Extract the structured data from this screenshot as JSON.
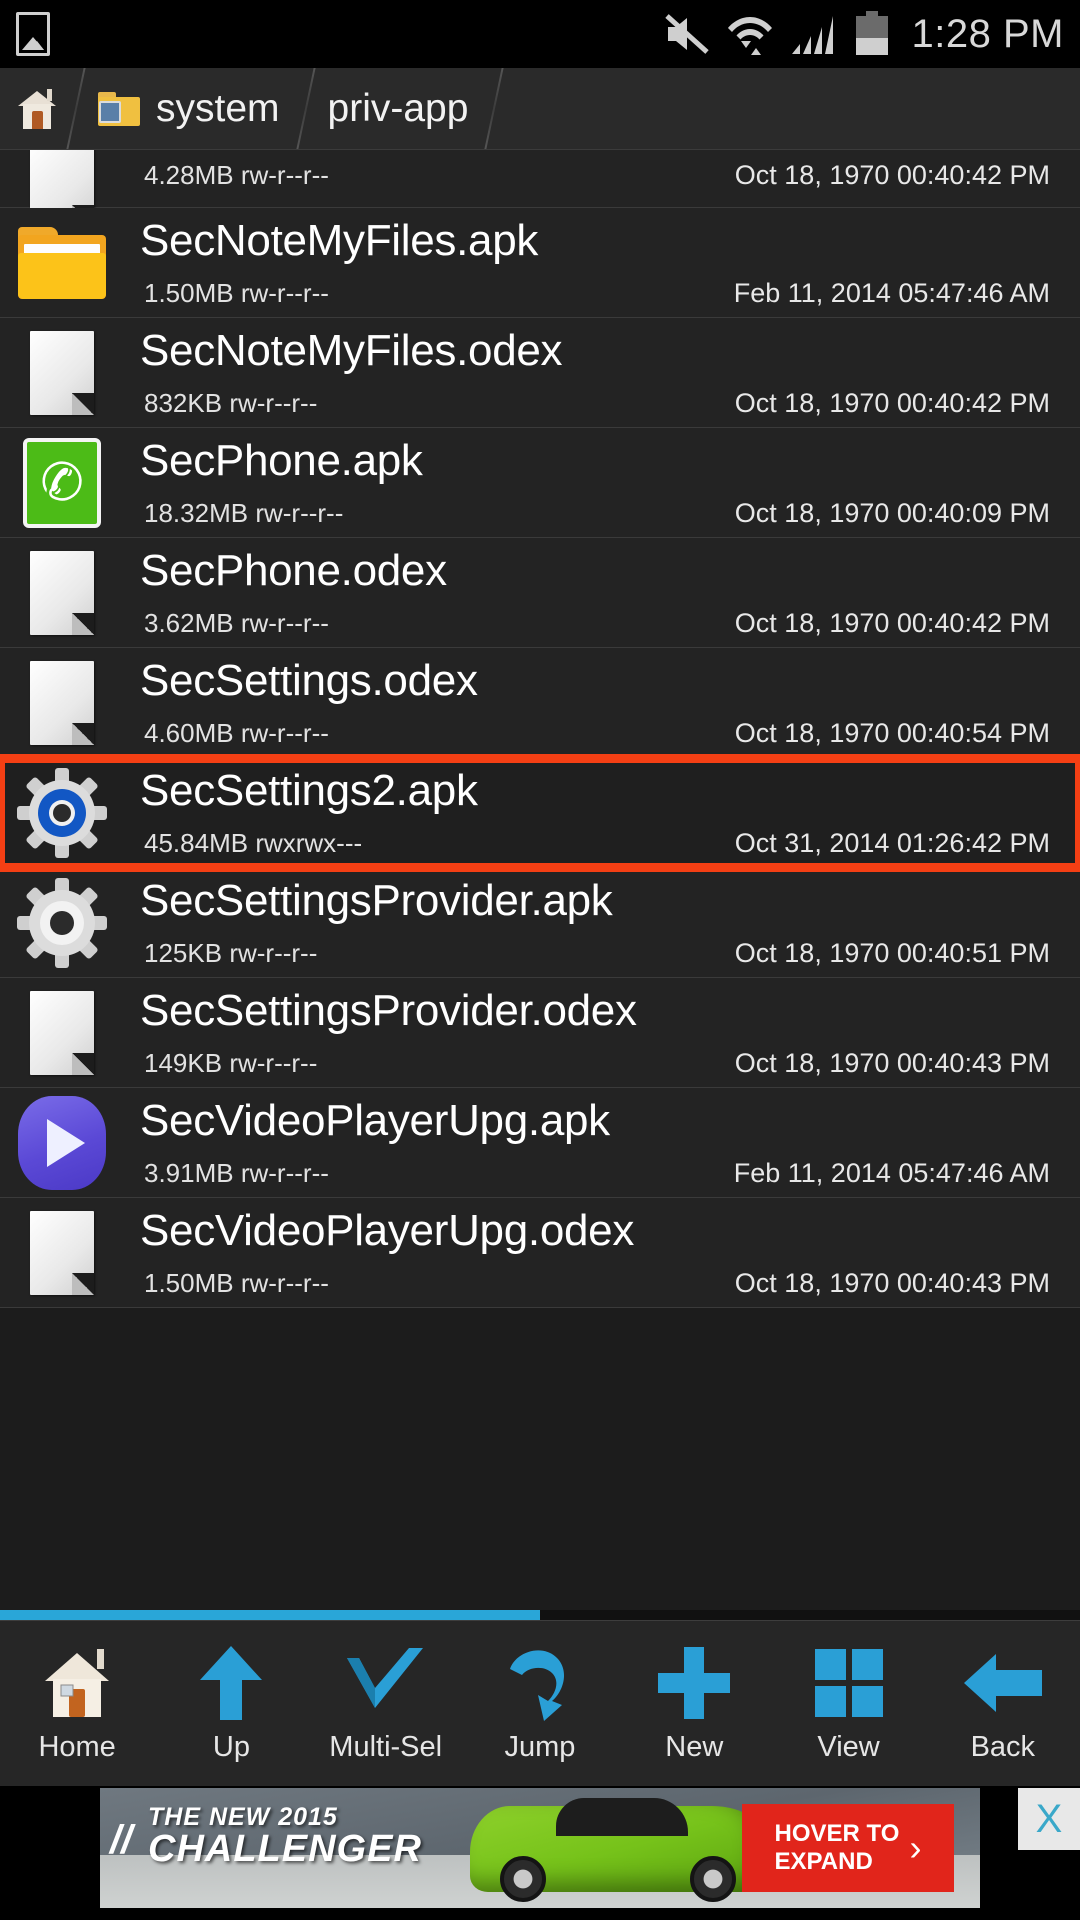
{
  "statusbar": {
    "time": "1:28 PM",
    "icons": [
      "photo-icon",
      "mute-icon",
      "wifi-icon",
      "signal-icon",
      "battery-icon"
    ]
  },
  "breadcrumb": {
    "home_label": "",
    "items": [
      {
        "label": "system",
        "icon": "folder-icon"
      },
      {
        "label": "priv-app",
        "icon": ""
      }
    ]
  },
  "filelist": {
    "rows": [
      {
        "name": "",
        "size": "4.28MB",
        "perms": "rw-r--r--",
        "date": "Oct 18, 1970 00:40:42 PM",
        "icon": "document-icon",
        "partial": true,
        "highlight": false
      },
      {
        "name": "SecNoteMyFiles.apk",
        "size": "1.50MB",
        "perms": "rw-r--r--",
        "date": "Feb 11, 2014 05:47:46 AM",
        "icon": "folder-icon",
        "partial": false,
        "highlight": false
      },
      {
        "name": "SecNoteMyFiles.odex",
        "size": "832KB",
        "perms": "rw-r--r--",
        "date": "Oct 18, 1970 00:40:42 PM",
        "icon": "document-icon",
        "partial": false,
        "highlight": false
      },
      {
        "name": "SecPhone.apk",
        "size": "18.32MB",
        "perms": "rw-r--r--",
        "date": "Oct 18, 1970 00:40:09 PM",
        "icon": "phone-icon",
        "partial": false,
        "highlight": false
      },
      {
        "name": "SecPhone.odex",
        "size": "3.62MB",
        "perms": "rw-r--r--",
        "date": "Oct 18, 1970 00:40:42 PM",
        "icon": "document-icon",
        "partial": false,
        "highlight": false
      },
      {
        "name": "SecSettings.odex",
        "size": "4.60MB",
        "perms": "rw-r--r--",
        "date": "Oct 18, 1970 00:40:54 PM",
        "icon": "document-icon",
        "partial": false,
        "highlight": false
      },
      {
        "name": "SecSettings2.apk",
        "size": "45.84MB",
        "perms": "rwxrwx---",
        "date": "Oct 31, 2014 01:26:42 PM",
        "icon": "gear-blue-icon",
        "partial": false,
        "highlight": true
      },
      {
        "name": "SecSettingsProvider.apk",
        "size": "125KB",
        "perms": "rw-r--r--",
        "date": "Oct 18, 1970 00:40:51 PM",
        "icon": "gear-icon",
        "partial": false,
        "highlight": false
      },
      {
        "name": "SecSettingsProvider.odex",
        "size": "149KB",
        "perms": "rw-r--r--",
        "date": "Oct 18, 1970 00:40:43 PM",
        "icon": "document-icon",
        "partial": false,
        "highlight": false
      },
      {
        "name": "SecVideoPlayerUpg.apk",
        "size": "3.91MB",
        "perms": "rw-r--r--",
        "date": "Feb 11, 2014 05:47:46 AM",
        "icon": "play-icon",
        "partial": false,
        "highlight": false
      },
      {
        "name": "SecVideoPlayerUpg.odex",
        "size": "1.50MB",
        "perms": "rw-r--r--",
        "date": "Oct 18, 1970 00:40:43 PM",
        "icon": "document-icon",
        "partial": false,
        "highlight": false
      }
    ],
    "scroll_percent": 50,
    "highlight_color": "#f43f14"
  },
  "toolbar": {
    "buttons": [
      {
        "label": "Home",
        "icon": "home-icon"
      },
      {
        "label": "Up",
        "icon": "arrow-up-icon"
      },
      {
        "label": "Multi-Sel",
        "icon": "checkmark-icon"
      },
      {
        "label": "Jump",
        "icon": "jump-arrow-icon"
      },
      {
        "label": "New",
        "icon": "plus-icon"
      },
      {
        "label": "View",
        "icon": "grid-view-icon"
      },
      {
        "label": "Back",
        "icon": "arrow-left-icon"
      }
    ],
    "accent_color": "#2a9fd6"
  },
  "ad": {
    "line1": "THE NEW 2015",
    "line2": "CHALLENGER",
    "cta_line1": "HOVER TO",
    "cta_line2": "EXPAND",
    "cta_arrow": "›",
    "close_label": "X",
    "cta_color": "#e1251b"
  }
}
